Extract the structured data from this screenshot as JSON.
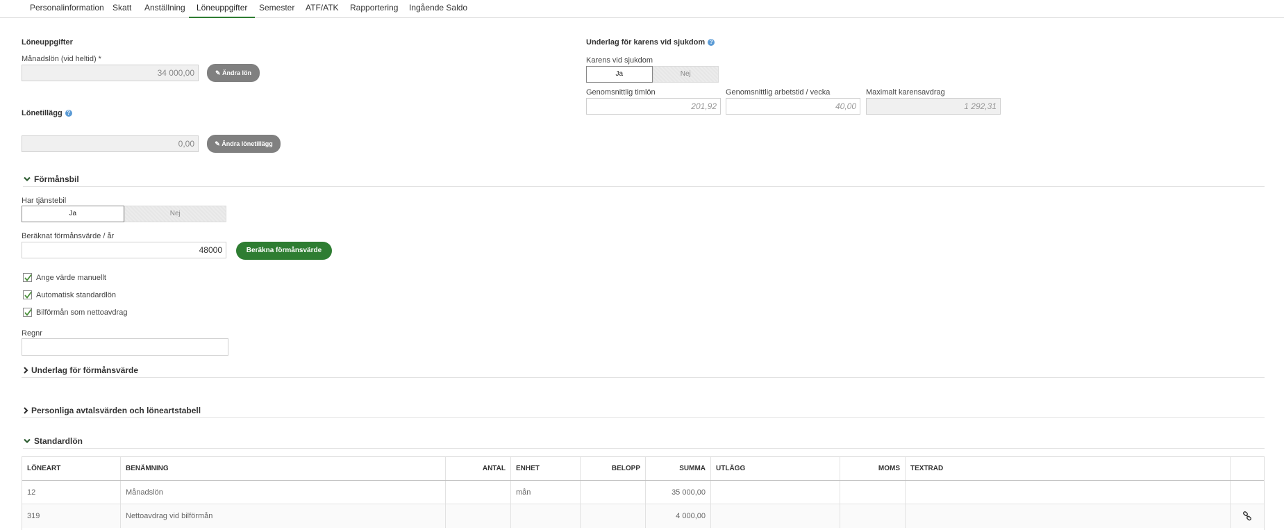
{
  "tabs": [
    {
      "label": "Personalinformation"
    },
    {
      "label": "Skatt"
    },
    {
      "label": "Anställning"
    },
    {
      "label": "Löneuppgifter"
    },
    {
      "label": "Semester"
    },
    {
      "label": "ATF/ATK"
    },
    {
      "label": "Rapportering"
    },
    {
      "label": "Ingående Saldo"
    }
  ],
  "active_tab": "Löneuppgifter",
  "loneuppgifter": {
    "title": "Löneuppgifter",
    "monthly_label": "Månadslön (vid heltid) *",
    "monthly_value": "34 000,00",
    "change_salary_button": "Ändra lön",
    "allowance_title": "Lönetillägg",
    "allowance_value": "0,00",
    "change_allowance_button": "Ändra lönetillägg"
  },
  "karens": {
    "title": "Underlag för karens vid sjukdom",
    "label": "Karens vid sjukdom",
    "yes": "Ja",
    "no": "Nej",
    "avg_hourly_label": "Genomsnittlig timlön",
    "avg_hourly_value": "201,92",
    "avg_hours_label": "Genomsnittlig arbetstid / vecka",
    "avg_hours_value": "40,00",
    "max_deduction_label": "Maximalt karensavdrag",
    "max_deduction_value": "1 292,31"
  },
  "formansbil": {
    "title": "Förmånsbil",
    "has_car_label": "Har tjänstebil",
    "yes": "Ja",
    "no": "Nej",
    "calc_label": "Beräknat förmånsvärde / år",
    "calc_value": "48000",
    "calc_button": "Beräkna förmånsvärde",
    "checkboxes": [
      {
        "label": "Ange värde manuellt",
        "checked": true
      },
      {
        "label": "Automatisk standardlön",
        "checked": true
      },
      {
        "label": "Bilförmån som nettoavdrag",
        "checked": true
      }
    ],
    "regnr_label": "Regnr",
    "regnr_value": ""
  },
  "sections": {
    "underlag": "Underlag för förmånsvärde",
    "personliga": "Personliga avtalsvärden och löneartstabell",
    "standardlon": "Standardlön"
  },
  "table": {
    "headers": [
      "LÖNEART",
      "BENÄMNING",
      "ANTAL",
      "ENHET",
      "BELOPP",
      "SUMMA",
      "UTLÄGG",
      "MOMS",
      "TEXTRAD",
      ""
    ],
    "rows": [
      [
        "12",
        "Månadslön",
        "",
        "mån",
        "",
        "35 000,00",
        "",
        "",
        "",
        ""
      ],
      [
        "319",
        "Nettoavdrag vid bilförmån",
        "",
        "",
        "",
        "4 000,00",
        "",
        "",
        "",
        ""
      ]
    ]
  },
  "colors": {
    "accent_green": "#2e7d32",
    "button_grey": "#808080",
    "help_blue": "#5b9bd5"
  },
  "icons": {
    "help": "question-circle-icon",
    "pencil": "pencil-icon",
    "chevron_down": "chevron-down-icon",
    "chevron_right": "chevron-right-icon",
    "link": "link-icon",
    "check": "check-icon"
  }
}
